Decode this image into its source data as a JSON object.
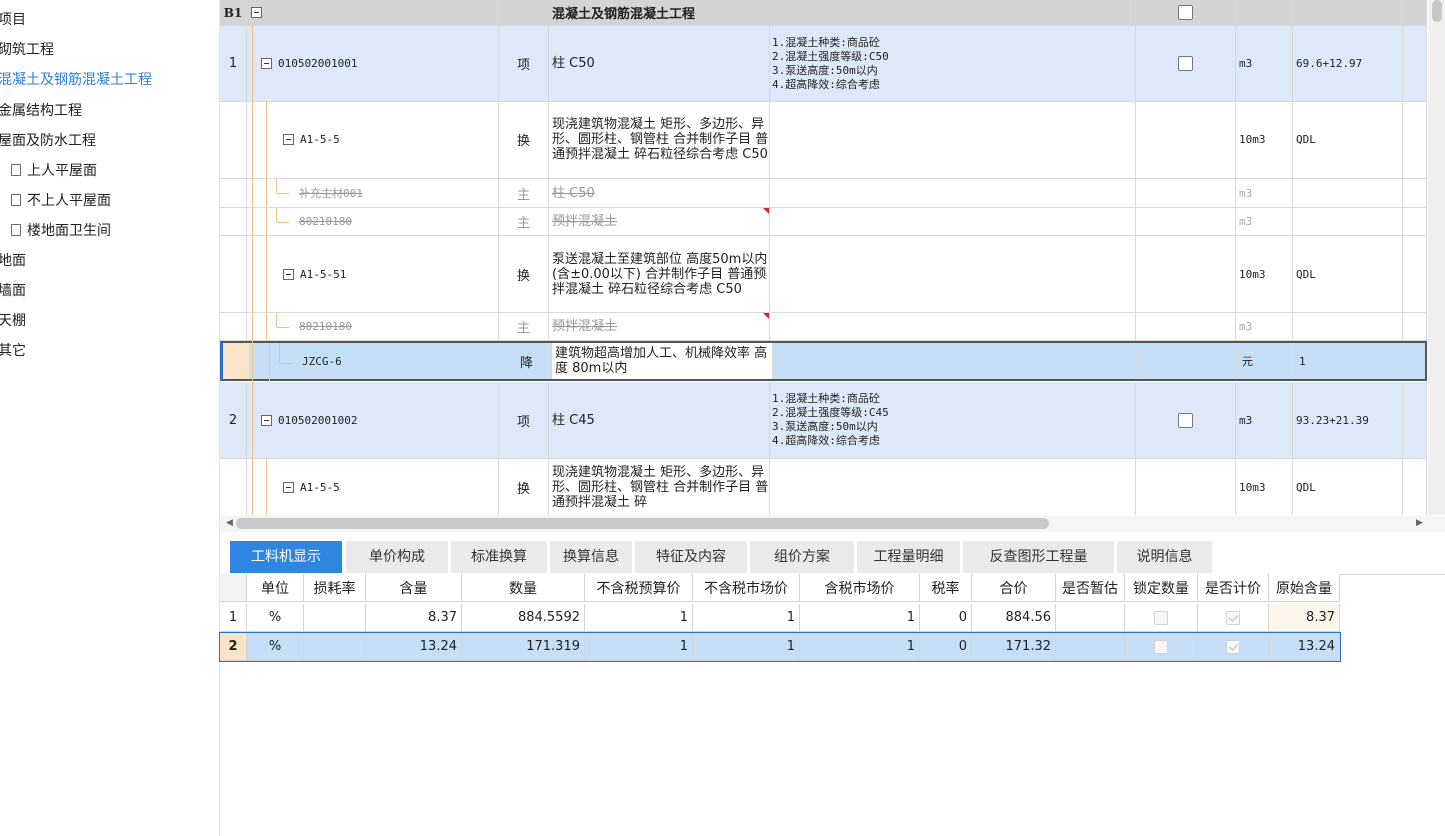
{
  "sidebar": {
    "items": [
      {
        "label": "项目",
        "icon": ""
      },
      {
        "label": "砌筑工程",
        "icon": ""
      },
      {
        "label": "混凝土及钢筋混凝土工程",
        "icon": "",
        "active": true
      },
      {
        "label": "金属结构工程",
        "icon": ""
      },
      {
        "label": "屋面及防水工程",
        "icon": ""
      },
      {
        "label": "上人平屋面",
        "icon": "file-icon"
      },
      {
        "label": "不上人平屋面",
        "icon": "file-icon"
      },
      {
        "label": "楼地面卫生间",
        "icon": "file-icon"
      },
      {
        "label": "地面",
        "icon": ""
      },
      {
        "label": "墙面",
        "icon": ""
      },
      {
        "label": "天棚",
        "icon": ""
      },
      {
        "label": "其它",
        "icon": ""
      }
    ]
  },
  "grid": {
    "section": {
      "num": "B1",
      "title": "混凝土及钢筋混凝土工程"
    },
    "rows": [
      {
        "num": "1",
        "code": "010502001001",
        "category": "项",
        "name": "柱 C50",
        "features": [
          "1.混凝土种类:商品砼",
          "2.混凝土强度等级:C50",
          "3.泵送高度:50m以内",
          "4.超高降效:综合考虑"
        ],
        "unit": "m3",
        "qty": "69.6+12.97",
        "type": "item"
      },
      {
        "num": "",
        "code": "A1-5-5",
        "category": "换",
        "name": "现浇建筑物混凝土 矩形、多边形、异形、圆形柱、钢管柱  合并制作子目 普通预拌混凝土 碎石粒径综合考虑 C50",
        "features": [],
        "unit": "10m3",
        "qty": "QDL",
        "type": "sub"
      },
      {
        "num": "",
        "code": "补充主材001",
        "category": "主",
        "name": "柱 C50",
        "features": [],
        "unit": "m3",
        "qty": "",
        "type": "mat"
      },
      {
        "num": "",
        "code": "80210180",
        "category": "主",
        "name": "预拌混凝土",
        "features": [],
        "unit": "m3",
        "qty": "",
        "type": "mat"
      },
      {
        "num": "",
        "code": "A1-5-51",
        "category": "换",
        "name": "泵送混凝土至建筑部位 高度50m以内(含±0.00以下)  合并制作子目 普通预拌混凝土 碎石粒径综合考虑 C50",
        "features": [],
        "unit": "10m3",
        "qty": "QDL",
        "type": "sub"
      },
      {
        "num": "",
        "code": "80210180",
        "category": "主",
        "name": "预拌混凝土",
        "features": [],
        "unit": "m3",
        "qty": "",
        "type": "mat"
      },
      {
        "num": "",
        "code": "JZCG-6",
        "category": "降",
        "name": "建筑物超高增加人工、机械降效率 高度 80m以内",
        "features": [],
        "unit": "元",
        "qty": "1",
        "type": "selected"
      },
      {
        "num": "2",
        "code": "010502001002",
        "category": "项",
        "name": "柱 C45",
        "features": [
          "1.混凝土种类:商品砼",
          "2.混凝土强度等级:C45",
          "3.泵送高度:50m以内",
          "4.超高降效:综合考虑"
        ],
        "unit": "m3",
        "qty": "93.23+21.39",
        "type": "item"
      },
      {
        "num": "",
        "code": "A1-5-5",
        "category": "换",
        "name": "现浇建筑物混凝土 矩形、多边形、异形、圆形柱、钢管柱  合并制作子目 普通预拌混凝土 碎",
        "features": [],
        "unit": "10m3",
        "qty": "QDL",
        "type": "sub"
      }
    ]
  },
  "tabs": [
    "工料机显示",
    "单价构成",
    "标准换算",
    "换算信息",
    "特征及内容",
    "组价方案",
    "工程量明细",
    "反查图形工程量",
    "说明信息"
  ],
  "subtable": {
    "headers": [
      "单位",
      "损耗率",
      "含量",
      "数量",
      "不含税预算价",
      "不含税市场价",
      "含税市场价",
      "税率",
      "合价",
      "是否暂估",
      "锁定数量",
      "是否计价",
      "原始含量"
    ],
    "rows": [
      {
        "num": "1",
        "unit": "%",
        "loss": "",
        "content": "8.37",
        "qty": "884.5592",
        "budget_price": "1",
        "market_price": "1",
        "tax_market_price": "1",
        "tax_rate": "0",
        "total": "884.56",
        "temp": "",
        "lock": false,
        "priced": true,
        "orig_content": "8.37"
      },
      {
        "num": "2",
        "unit": "%",
        "loss": "",
        "content": "13.24",
        "qty": "171.319",
        "budget_price": "1",
        "market_price": "1",
        "tax_market_price": "1",
        "tax_rate": "0",
        "total": "171.32",
        "temp": "",
        "lock": false,
        "priced": true,
        "orig_content": "13.24"
      }
    ]
  },
  "colors": {
    "accent": "#2f86e0",
    "item_row": "#dde9f8",
    "selected_row": "#c6dff6",
    "section_row": "#d4d4d4",
    "red_marker": "#e02020"
  }
}
